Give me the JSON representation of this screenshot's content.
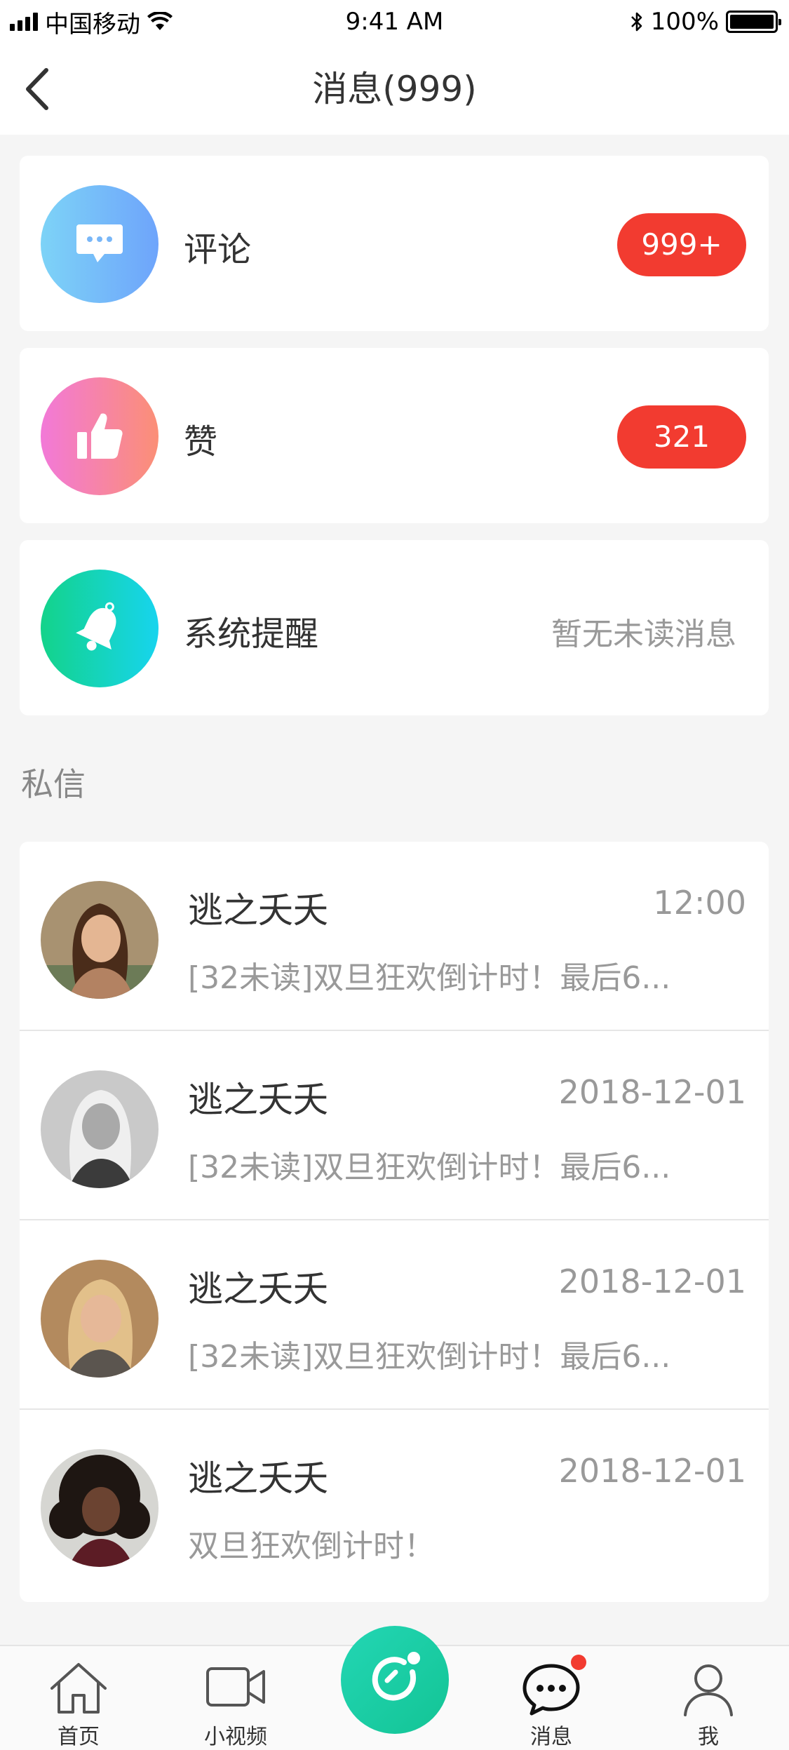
{
  "status_bar": {
    "carrier": "中国移动",
    "time": "9:41 AM",
    "battery": "100%",
    "icons": [
      "signal-icon",
      "wifi-icon",
      "bluetooth-icon",
      "battery-icon"
    ]
  },
  "nav": {
    "title": "消息(999)",
    "back_icon": "chevron-left-icon"
  },
  "entries": [
    {
      "label": "评论",
      "badge": "999+",
      "icon": "comment-bubble-icon",
      "colors": [
        "#7dd3f7",
        "#6ea4fb"
      ]
    },
    {
      "label": "赞",
      "badge": "321",
      "icon": "thumbs-up-icon",
      "colors": [
        "#f279d8",
        "#fb8f76"
      ]
    },
    {
      "label": "系统提醒",
      "status": "暂无未读消息",
      "icon": "bell-icon",
      "colors": [
        "#13d38a",
        "#17d4ee"
      ]
    }
  ],
  "section": {
    "private_messages_label": "私信"
  },
  "messages": [
    {
      "name": "逃之夭夭",
      "time": "12:00",
      "preview": "[32未读]双旦狂欢倒计时！最后6...",
      "avatar": "avatar-photo"
    },
    {
      "name": "逃之夭夭",
      "time": "2018-12-01",
      "preview": "[32未读]双旦狂欢倒计时！最后6...",
      "avatar": "avatar-photo"
    },
    {
      "name": "逃之夭夭",
      "time": "2018-12-01",
      "preview": "[32未读]双旦狂欢倒计时！最后6...",
      "avatar": "avatar-photo"
    },
    {
      "name": "逃之夭夭",
      "time": "2018-12-01",
      "preview": "双旦狂欢倒计时！",
      "avatar": "avatar-photo"
    }
  ],
  "tabbar": {
    "items": [
      {
        "label": "首页",
        "icon": "home-icon"
      },
      {
        "label": "小视频",
        "icon": "video-camera-icon"
      },
      {
        "label": "",
        "icon": "center-action-icon"
      },
      {
        "label": "消息",
        "icon": "chat-bubble-icon",
        "active": true
      },
      {
        "label": "我",
        "icon": "user-icon"
      }
    ]
  },
  "colors": {
    "badge_red": "#f23b30",
    "background": "#f5f5f5",
    "card": "#ffffff",
    "muted_text": "#999999"
  }
}
